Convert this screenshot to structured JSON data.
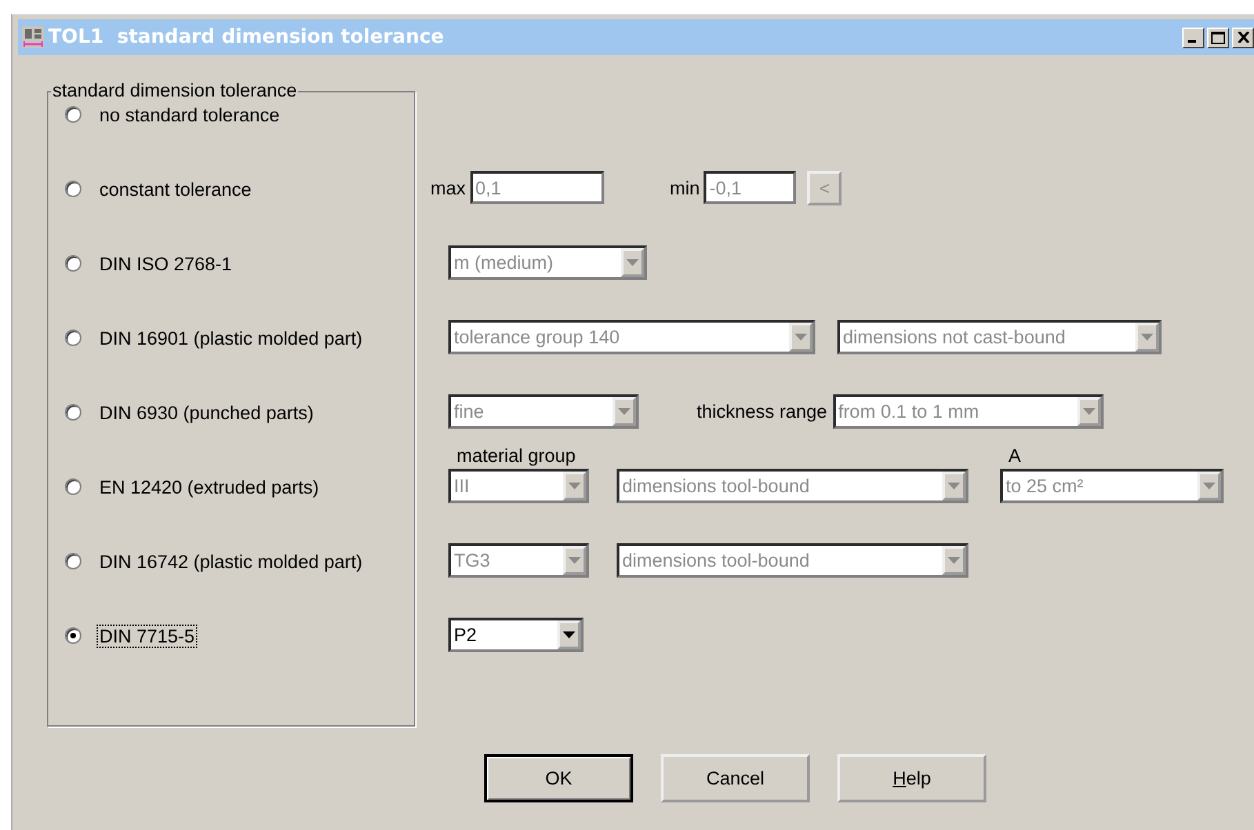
{
  "window": {
    "title": "TOL1  standard dimension tolerance"
  },
  "group": {
    "title": "standard dimension tolerance"
  },
  "options": [
    {
      "label": "no standard tolerance",
      "selected": false,
      "focused": false
    },
    {
      "label": "constant tolerance",
      "selected": false,
      "focused": false,
      "controls": [
        {
          "kind": "label",
          "text": "max"
        },
        {
          "kind": "field",
          "value": "0,1",
          "disabled": true
        },
        {
          "kind": "label",
          "text": "min"
        },
        {
          "kind": "field",
          "value": "-0,1",
          "disabled": true
        },
        {
          "kind": "button",
          "text": "<",
          "disabled": true
        }
      ]
    },
    {
      "label": "DIN ISO 2768-1",
      "selected": false,
      "focused": false,
      "controls": [
        {
          "kind": "combo",
          "value": "m (medium)",
          "disabled": true
        }
      ]
    },
    {
      "label": "DIN 16901 (plastic molded part)",
      "selected": false,
      "focused": false,
      "controls": [
        {
          "kind": "combo",
          "value": "tolerance group 140",
          "disabled": true
        },
        {
          "kind": "combo",
          "value": "dimensions not cast-bound",
          "disabled": true
        }
      ]
    },
    {
      "label": "DIN 6930 (punched parts)",
      "selected": false,
      "focused": false,
      "controls": [
        {
          "kind": "combo",
          "value": "fine",
          "disabled": true
        },
        {
          "kind": "label",
          "text": "thickness range"
        },
        {
          "kind": "combo",
          "value": "from 0.1 to 1 mm",
          "disabled": true
        }
      ]
    },
    {
      "label": "EN 12420 (extruded parts)",
      "selected": false,
      "focused": false,
      "controls": [
        {
          "kind": "combo",
          "caption": "material group",
          "value": "III",
          "disabled": true
        },
        {
          "kind": "combo",
          "value": "dimensions tool-bound",
          "disabled": true
        },
        {
          "kind": "combo",
          "caption": "A",
          "value": "to 25 cm²",
          "disabled": true
        }
      ]
    },
    {
      "label": "DIN 16742 (plastic molded part)",
      "selected": false,
      "focused": false,
      "controls": [
        {
          "kind": "combo",
          "value": "TG3",
          "disabled": true
        },
        {
          "kind": "combo",
          "value": "dimensions tool-bound",
          "disabled": true
        }
      ]
    },
    {
      "label": "DIN 7715-5",
      "selected": true,
      "focused": true,
      "controls": [
        {
          "kind": "combo",
          "value": "P2",
          "disabled": false
        }
      ]
    }
  ],
  "buttons": [
    {
      "label": "OK",
      "default": true,
      "mnemonic": false
    },
    {
      "label": "Cancel",
      "default": false,
      "mnemonic": false
    },
    {
      "label": "Help",
      "default": false,
      "mnemonic": true
    }
  ]
}
